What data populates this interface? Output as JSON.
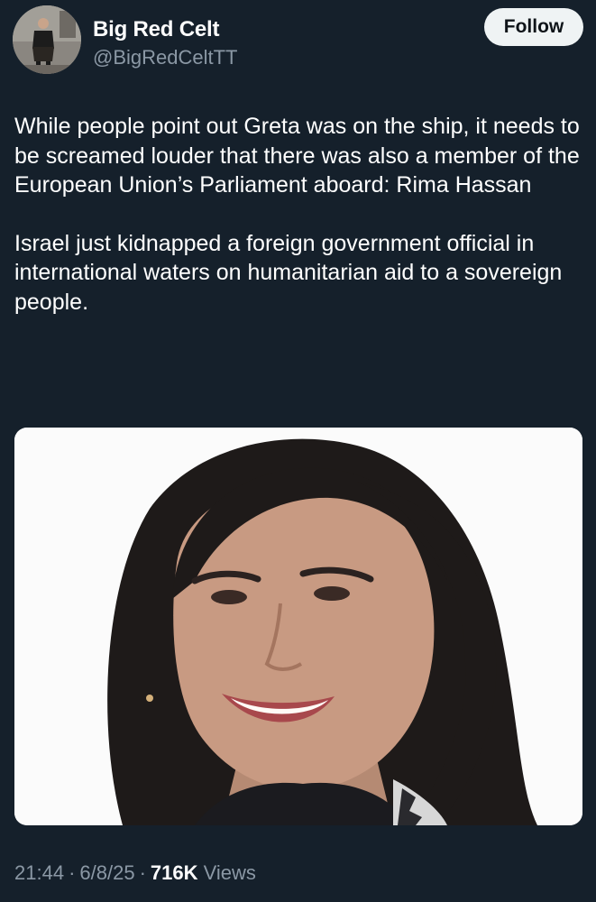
{
  "author": {
    "display_name": "Big Red Celt",
    "handle": "@BigRedCeltTT",
    "avatar_icon": "profile-photo-icon"
  },
  "actions": {
    "follow_label": "Follow"
  },
  "tweet": {
    "paragraphs": [
      "While people point out Greta was on the ship, it needs to be screamed louder that there was also a member of the European Union’s Parliament aboard: Rima Hassan",
      "Israel just kidnapped a foreign government official in international waters on humanitarian aid to a sovereign people."
    ]
  },
  "meta": {
    "time": "21:44",
    "date": "6/8/25",
    "views_count": "716K",
    "views_label": "Views",
    "separator": "·"
  },
  "colors": {
    "background": "#15202b",
    "text_primary": "#ffffff",
    "text_secondary": "#8b98a5",
    "follow_button_bg": "#eff3f4",
    "follow_button_text": "#0f1419"
  }
}
